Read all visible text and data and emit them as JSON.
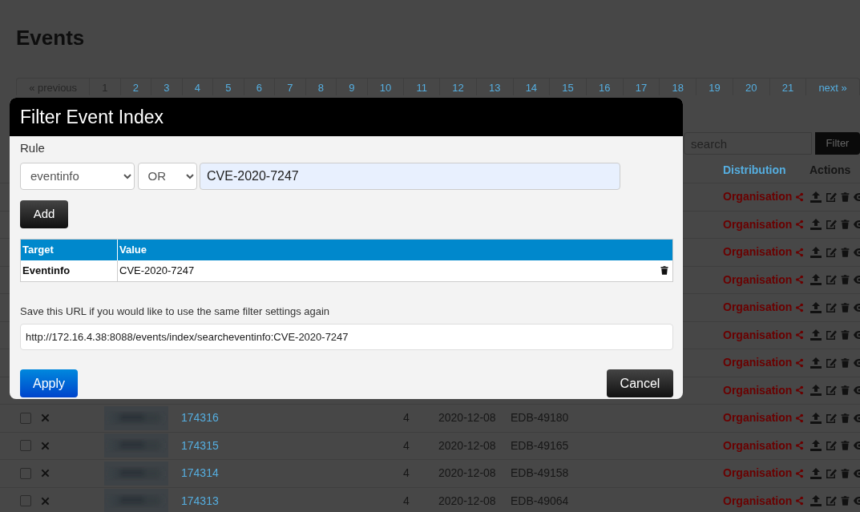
{
  "page": {
    "title": "Events"
  },
  "pagination": [
    {
      "label": "« previous",
      "disabled": true
    },
    {
      "label": "1",
      "disabled": true
    },
    {
      "label": "2",
      "disabled": false
    },
    {
      "label": "3",
      "disabled": false
    },
    {
      "label": "4",
      "disabled": false
    },
    {
      "label": "5",
      "disabled": false
    },
    {
      "label": "6",
      "disabled": false
    },
    {
      "label": "7",
      "disabled": false
    },
    {
      "label": "8",
      "disabled": false
    },
    {
      "label": "9",
      "disabled": false
    },
    {
      "label": "10",
      "disabled": false
    },
    {
      "label": "11",
      "disabled": false
    },
    {
      "label": "12",
      "disabled": false
    },
    {
      "label": "13",
      "disabled": false
    },
    {
      "label": "14",
      "disabled": false
    },
    {
      "label": "15",
      "disabled": false
    },
    {
      "label": "16",
      "disabled": false
    },
    {
      "label": "17",
      "disabled": false
    },
    {
      "label": "18",
      "disabled": false
    },
    {
      "label": "19",
      "disabled": false
    },
    {
      "label": "20",
      "disabled": false
    },
    {
      "label": "21",
      "disabled": false
    },
    {
      "label": "next »",
      "disabled": false
    }
  ],
  "search": {
    "placeholder": "search",
    "button": "Filter"
  },
  "table": {
    "columns": [
      "Distribution",
      "Actions"
    ],
    "rows": [
      {
        "distribution": "Organisation"
      },
      {
        "distribution": "Organisation"
      },
      {
        "distribution": "Organisation"
      },
      {
        "distribution": "Organisation"
      },
      {
        "distribution": "Organisation"
      },
      {
        "distribution": "Organisation"
      },
      {
        "distribution": "Organisation"
      },
      {
        "distribution": "Organisation"
      },
      {
        "checked": false,
        "id": "174316",
        "count": "4",
        "date": "2020-12-08",
        "info": "EDB-49180",
        "distribution": "Organisation"
      },
      {
        "checked": false,
        "id": "174315",
        "count": "4",
        "date": "2020-12-08",
        "info": "EDB-49165",
        "distribution": "Organisation"
      },
      {
        "checked": false,
        "id": "174314",
        "count": "4",
        "date": "2020-12-08",
        "info": "EDB-49158",
        "distribution": "Organisation"
      },
      {
        "checked": false,
        "id": "174313",
        "count": "4",
        "date": "2020-12-08",
        "info": "EDB-49064",
        "distribution": "Organisation"
      }
    ]
  },
  "modal": {
    "title": "Filter Event Index",
    "rule_label": "Rule",
    "field_select": "eventinfo",
    "operator_select": "OR",
    "value": "CVE-2020-7247",
    "add_button": "Add",
    "filter_table": {
      "columns": [
        "Target",
        "Value"
      ],
      "rows": [
        {
          "target": "Eventinfo",
          "value": "CVE-2020-7247"
        }
      ]
    },
    "url_label": "Save this URL if you would like to use the same filter settings again",
    "url": "http://172.16.4.38:8088/events/index/searcheventinfo:CVE-2020-7247",
    "apply_button": "Apply",
    "cancel_button": "Cancel"
  }
}
